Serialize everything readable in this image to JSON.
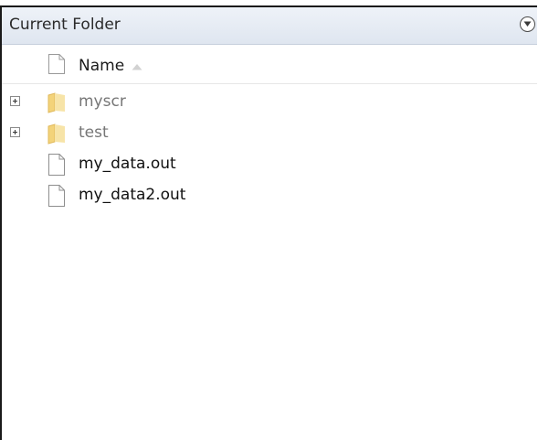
{
  "panel": {
    "title": "Current Folder",
    "menu_icon": "circle-chevron-down-icon"
  },
  "columns": {
    "name_label": "Name",
    "sort": "ascending"
  },
  "items": [
    {
      "name": "myscr",
      "type": "folder",
      "expandable": true
    },
    {
      "name": "test",
      "type": "folder",
      "expandable": true
    },
    {
      "name": "my_data.out",
      "type": "file",
      "expandable": false
    },
    {
      "name": "my_data2.out",
      "type": "file",
      "expandable": false
    }
  ],
  "colors": {
    "folder_text": "#767676",
    "file_text": "#111111",
    "folder_fill": "#f3d37a"
  }
}
